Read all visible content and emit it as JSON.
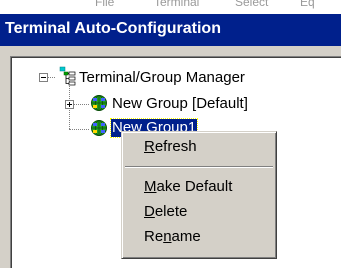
{
  "background_menu_fragment": [
    "File",
    "Terminal",
    "Select",
    "Eq"
  ],
  "window": {
    "title": "Terminal Auto-Configuration"
  },
  "tree": {
    "root_label": "Terminal/Group Manager",
    "children": [
      {
        "label": "New Group [Default]",
        "expanded": false
      },
      {
        "label": "New Group1",
        "selected": true
      }
    ]
  },
  "context_menu": {
    "items": [
      {
        "pre": "",
        "mn": "R",
        "post": "efresh"
      },
      {
        "pre": "",
        "mn": "M",
        "post": "ake Default"
      },
      {
        "pre": "",
        "mn": "D",
        "post": "elete"
      },
      {
        "pre": "Re",
        "mn": "n",
        "post": "ame"
      }
    ]
  },
  "colors": {
    "title_bg": "#00208c",
    "face": "#d4d0c8",
    "selection": "#00208c"
  }
}
